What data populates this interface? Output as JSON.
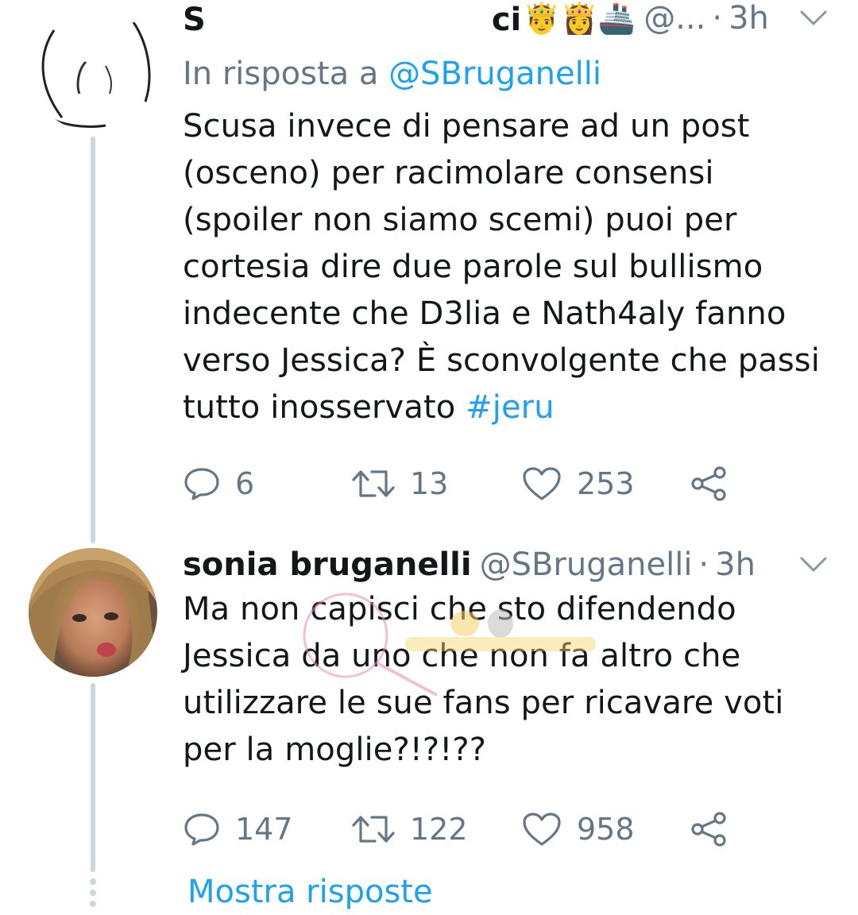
{
  "tweets": [
    {
      "display_name": "S",
      "display_name_tail": "ci",
      "emojis": "🤴👸🚢",
      "handle": "@...",
      "separator": "·",
      "time": "3h",
      "reply_prefix": "In risposta a",
      "reply_mention": "@SBruganelli",
      "text": "Scusa invece di pensare ad un post (osceno) per racimolare consensi (spoiler non siamo scemi) puoi per cortesia dire due parole sul bullismo indecente che D3lia e Nath4aly fanno verso Jessica? È sconvolgente che passi tutto inosservato",
      "hashtag": "#jeru",
      "reply_count": "6",
      "retweet_count": "13",
      "like_count": "253"
    },
    {
      "display_name": "sonia bruganelli",
      "handle": "@SBruganelli",
      "separator": "·",
      "time": "3h",
      "text": "Ma non capisci che sto difendendo Jessica da uno che non fa altro che utilizzare le sue fans per ricavare voti per la moglie?!?!??",
      "reply_count": "147",
      "retweet_count": "122",
      "like_count": "958"
    }
  ],
  "show_replies_label": "Mostra risposte",
  "icons": {
    "reply": "reply-icon",
    "retweet": "retweet-icon",
    "like": "heart-icon",
    "share": "share-icon",
    "menu": "chevron-down-icon"
  },
  "colors": {
    "text": "#14171a",
    "secondary": "#657786",
    "accent": "#1da1f2",
    "thread_line": "#ccd6dd"
  }
}
